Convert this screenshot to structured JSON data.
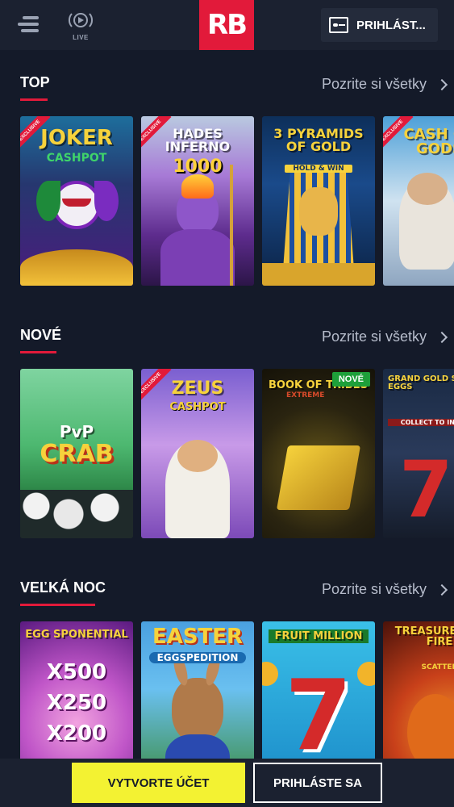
{
  "header": {
    "logo": "RB",
    "live_label": "LIVE",
    "login_label": "PRIHLÁST..."
  },
  "sections": [
    {
      "title": "TOP",
      "see_all": "Pozrite si všetky",
      "games": [
        {
          "title": "JOKER",
          "sub": "CASHPOT",
          "badge": "EXCLUSIVE"
        },
        {
          "title": "HADES INFERNO",
          "sub": "1000",
          "badge": "EXCLUSIVE"
        },
        {
          "title": "3 PYRAMIDS OF GOLD",
          "sub": "HOLD & WIN",
          "badge": ""
        },
        {
          "title": "CASH OF GODS",
          "sub": "",
          "badge": "EXCLUSIVE"
        }
      ]
    },
    {
      "title": "NOVÉ",
      "see_all": "Pozrite si všetky",
      "games": [
        {
          "title": "PvP",
          "sub": "CRAB",
          "badge": ""
        },
        {
          "title": "ZEUS",
          "sub": "CASHPOT",
          "badge": "EXCLUSIVE"
        },
        {
          "title": "BOOK OF TRIBES",
          "sub": "EXTREME",
          "badge": "NOVÉ"
        },
        {
          "title": "GRAND GOLD SIZZLING EGGS",
          "sub": "COLLECT TO INFINITY",
          "badge": ""
        }
      ]
    },
    {
      "title": "VEĽKÁ NOC",
      "see_all": "Pozrite si všetky",
      "games": [
        {
          "title": "EGG SPONENTIAL",
          "sub": "",
          "badge": "",
          "multipliers": [
            "X500",
            "X250",
            "X200"
          ]
        },
        {
          "title": "EASTER",
          "sub": "EGGSPEDITION",
          "badge": ""
        },
        {
          "title": "FRUIT MILLION",
          "sub": "",
          "badge": ""
        },
        {
          "title": "TREASURES OF FIRE",
          "sub": "SCATTER",
          "badge": ""
        }
      ]
    }
  ],
  "footer": {
    "create_label": "VYTVORTE ÚČET",
    "login_label": "PRIHLÁSTE SA"
  },
  "colors": {
    "background": "#141a29",
    "accent": "#e21a3a",
    "cta": "#f3f232"
  }
}
